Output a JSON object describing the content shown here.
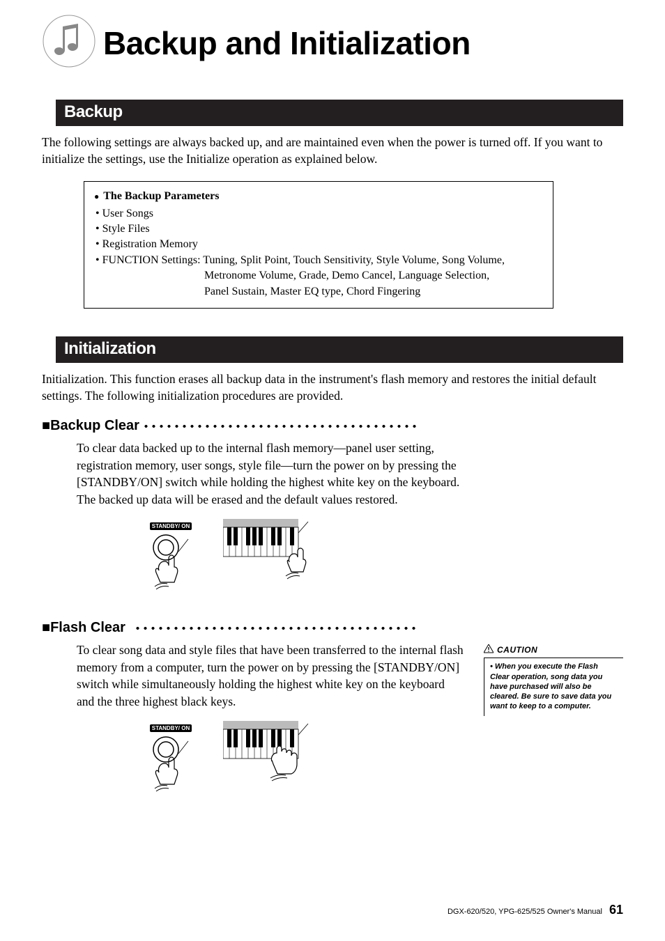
{
  "page": {
    "title": "Backup and Initialization",
    "footer_text": "DGX-620/520, YPG-625/525  Owner's Manual",
    "page_number": "61"
  },
  "backup": {
    "heading": "Backup",
    "intro": "The following settings are always backed up, and are maintained even when the power is turned off. If you want to initialize the settings, use the Initialize operation as explained below.",
    "box_title": "The Backup Parameters",
    "items": {
      "a": "User Songs",
      "b": "Style Files",
      "c": "Registration Memory",
      "d_label": "FUNCTION Settings:",
      "d_line1": "Tuning, Split Point, Touch Sensitivity, Style Volume, Song Volume,",
      "d_line2": "Metronome Volume, Grade, Demo Cancel, Language Selection,",
      "d_line3": "Panel Sustain, Master EQ type, Chord Fingering"
    }
  },
  "init": {
    "heading": "Initialization",
    "intro": "Initialization. This function erases all backup data in the instrument's flash memory and restores the initial default settings. The following initialization procedures are provided."
  },
  "backup_clear": {
    "heading": "■Backup Clear",
    "body": "To clear data backed up to the internal flash memory—panel user setting, registration memory, user songs, style file—turn the power on by pressing the [STANDBY/ON] switch while holding the highest white key on the keyboard. The backed up data will be erased and the default values restored.",
    "button_label": "STANDBY/ ON"
  },
  "flash_clear": {
    "heading": "■Flash Clear",
    "body": "To clear song data and style files that have been transferred to the internal flash memory from a computer, turn the power on by pressing the [STANDBY/ON] switch while simultaneously holding the highest white key on the keyboard and the three highest black keys.",
    "button_label": "STANDBY/ ON"
  },
  "caution": {
    "label": "CAUTION",
    "bullet": "•",
    "text": "When you execute the Flash Clear operation, song data you have purchased will also be cleared. Be sure to save data you want to keep to a computer."
  }
}
